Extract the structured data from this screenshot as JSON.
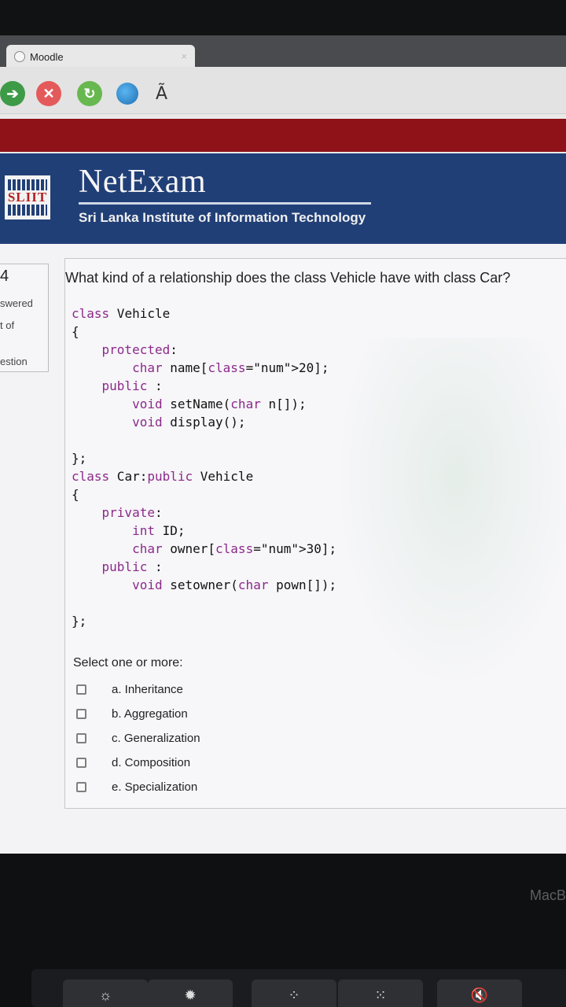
{
  "browser": {
    "tab_title": "Moodle",
    "tab_close": "×",
    "toolbar_char": "Ã",
    "icons": [
      "back-icon",
      "stop-icon",
      "reload-icon",
      "globe-icon"
    ]
  },
  "banner": {
    "logo_text": "SLIIT",
    "title": "NetExam",
    "subtitle": "Sri Lanka Institute of Information Technology",
    "colors": {
      "banner": "#213f77",
      "red_band": "#8e1218"
    }
  },
  "info": {
    "question_number": "4",
    "status": "swered",
    "marks": "t of",
    "flag": "estion"
  },
  "question": {
    "text": "What kind of a relationship does the class Vehicle have with class Car?",
    "code_lines": [
      "class Vehicle",
      "{",
      "    protected:",
      "        char name[20];",
      "    public :",
      "        void setName(char n[]);",
      "        void display();",
      "",
      "};",
      "class Car:public Vehicle",
      "{",
      "    private:",
      "        int ID;",
      "        char owner[30];",
      "    public :",
      "        void setowner(char pown[]);",
      "",
      "};"
    ],
    "select_label": "Select one or more:",
    "options": [
      {
        "label": "a. Inheritance",
        "checked": false
      },
      {
        "label": "b. Aggregation",
        "checked": false
      },
      {
        "label": "c. Generalization",
        "checked": false
      },
      {
        "label": "d. Composition",
        "checked": false
      },
      {
        "label": "e. Specialization",
        "checked": false
      }
    ]
  },
  "device": {
    "brand": "MacB",
    "touchbar_icons": [
      "brightness-low-icon",
      "brightness-high-icon",
      "keyboard-light-low-icon",
      "keyboard-light-high-icon",
      "mute-icon"
    ],
    "touchbar_glyphs": [
      "☼",
      "✹",
      "⁘",
      "⁙",
      "🔇"
    ]
  }
}
